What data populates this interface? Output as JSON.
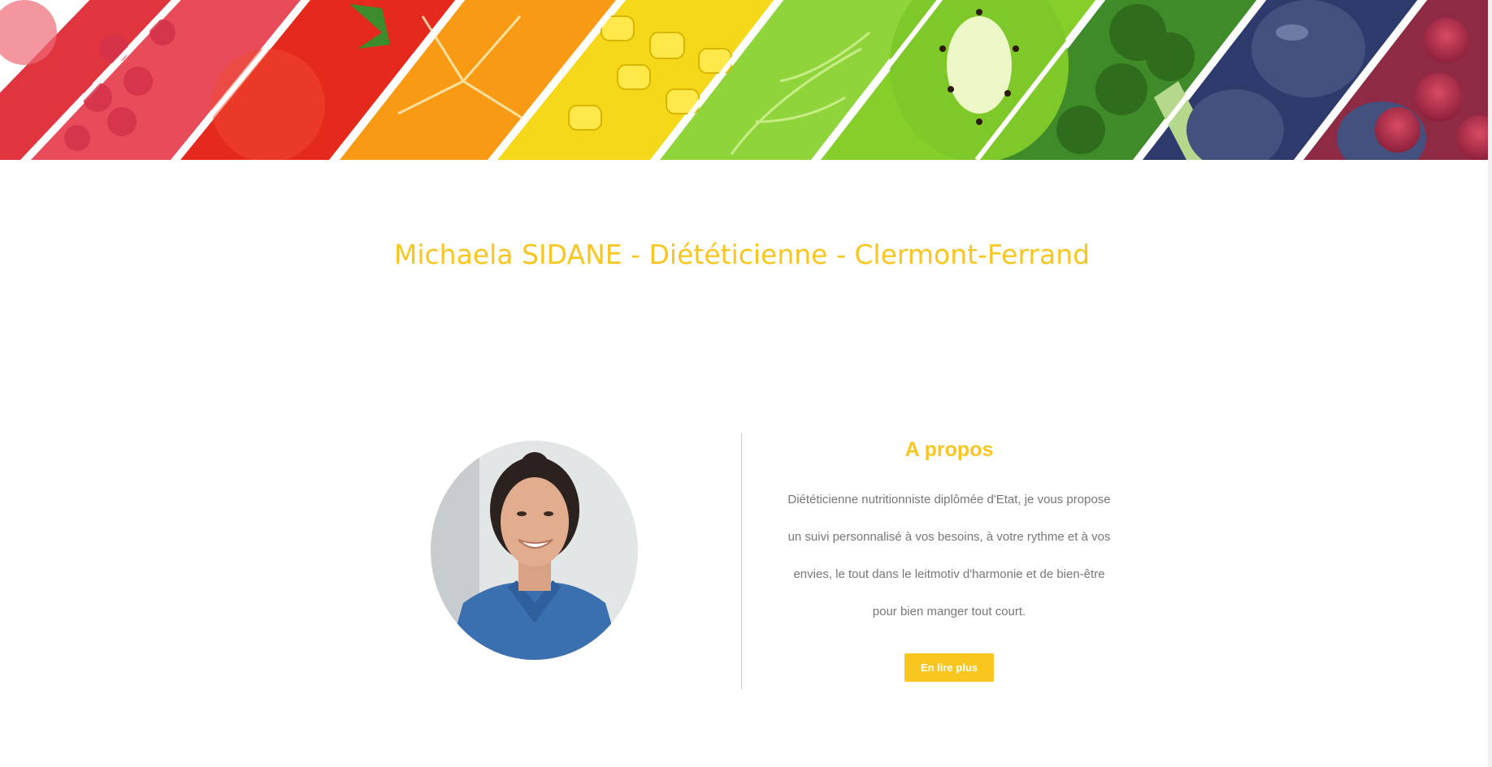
{
  "colors": {
    "accent": "#f8c61e",
    "text_muted": "#777777",
    "divider": "#c8c8c8"
  },
  "banner": {
    "icon": "fruits-vegetables-banner-image"
  },
  "header": {
    "site_title": "Michaela SIDANE - Diététicienne - Clermont-Ferrand"
  },
  "about": {
    "photo_icon": "portrait-photo",
    "title": "A propos",
    "lines": [
      "Diététicienne nutritionniste diplômée d'Etat, je vous propose",
      "un suivi personnalisé à vos besoins, à votre rythme et à vos",
      "envies, le tout dans le leitmotiv d'harmonie et de bien-être",
      "pour bien manger tout court."
    ],
    "button_label": "En lire plus"
  }
}
